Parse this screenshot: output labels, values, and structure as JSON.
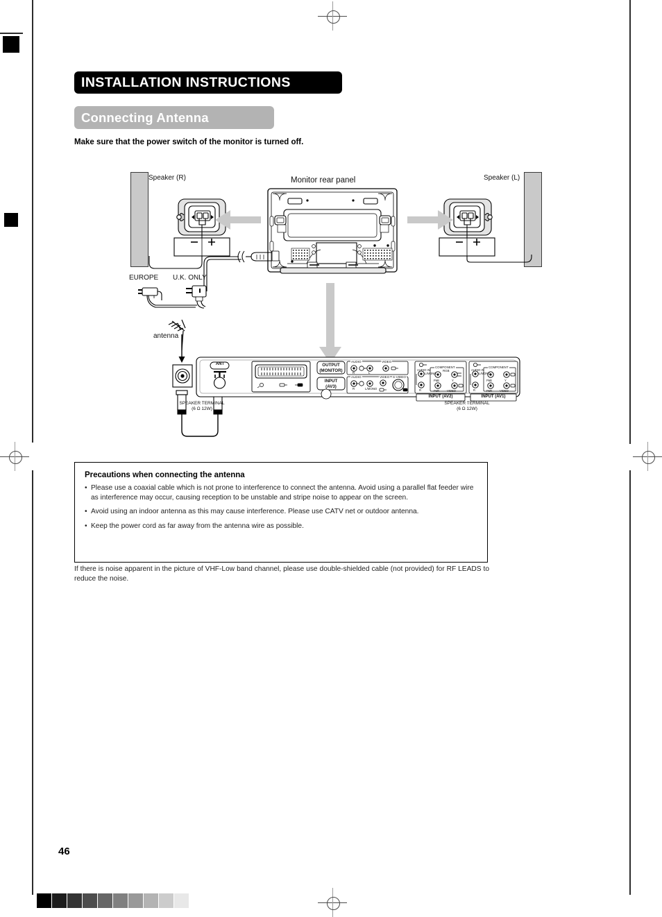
{
  "header": {
    "main_title": "INSTALLATION INSTRUCTIONS",
    "section_title": "Connecting Antenna",
    "lead_line": "Make sure that the power switch of the monitor is turned off."
  },
  "diagram": {
    "speaker_right_label": "Speaker (R)",
    "speaker_left_label": "Speaker (L)",
    "monitor_label": "Monitor rear panel",
    "antenna_label": "antenna",
    "plug_europe_label": "EUROPE",
    "plug_uk_label": "U.K. ONLY",
    "speaker_terminal_line1": "SPEAKER TERMINAL",
    "speaker_terminal_line2": "(6 Ω 12W)",
    "terminal_minus": "–",
    "terminal_plus": "+",
    "panel": {
      "ant_label": "ANT",
      "output_monitor_l1": "OUTPUT",
      "output_monitor_l2": "(MONITOR)",
      "input_av3_l1": "INPUT",
      "input_av3_l2": "(AV3)",
      "audio_label": "AUDIO",
      "video_label": "VIDEO",
      "svideo_label": "S-VIDEO",
      "audio_r": "R",
      "audio_l": "L",
      "audio_l_mono": "L/MONO",
      "audio_in": "AUDIO IN",
      "component_label": "COMPONENT",
      "comp_y": "Y",
      "comp_pb": "PʙB",
      "comp_pr": "PʙR",
      "rgb_label": "RGB",
      "input_av2": "INPUT (AV2)",
      "input_av1": "INPUT (AV1)"
    }
  },
  "precautions": {
    "title": "Precautions when connecting the antenna",
    "bullet": "•",
    "items": [
      "Please use a coaxial cable which is not prone to interference to connect the antenna. Avoid using a parallel flat feeder wire as interference may occur, causing reception to be unstable and stripe noise to appear on the screen.",
      "Avoid using an indoor antenna as this may cause interference. Please use CATV net or outdoor antenna.",
      "Keep the power cord as far away from the antenna wire as possible."
    ]
  },
  "footer": {
    "note": "If there is noise apparent in the picture of VHF-Low band channel, please use double-shielded cable (not provided) for RF LEADS to reduce the noise.",
    "page_number": "46"
  },
  "color_strip": [
    "#000000",
    "#1c1c1c",
    "#343434",
    "#4d4d4d",
    "#666666",
    "#808080",
    "#999999",
    "#b3b3b3",
    "#cccccc",
    "#e8e8e8"
  ]
}
